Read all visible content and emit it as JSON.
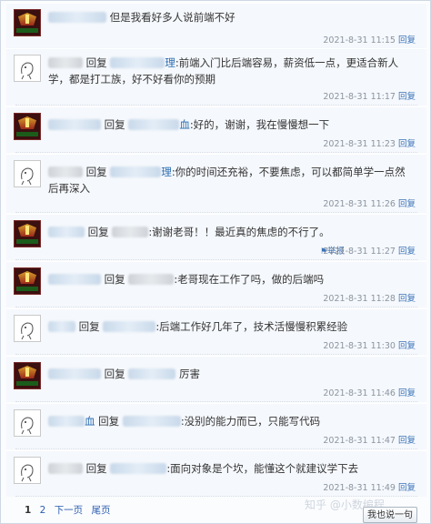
{
  "comments": [
    {
      "avatar": "game",
      "prefix": "",
      "reply_label": "",
      "mention_suffix": "",
      "text": "但是我看好多人说前端不好",
      "line2": "",
      "time": "2021-8-31 11:15",
      "action": "回复"
    },
    {
      "avatar": "sketch",
      "prefix": "",
      "reply_label": "回复",
      "mention_suffix": "理",
      "text": ":前端入门比后端容易，薪资低一点，更适合新人",
      "line2": "学，都是打工族，好不好看你的预期",
      "time": "2021-8-31 11:17",
      "action": "回复"
    },
    {
      "avatar": "game",
      "prefix": "",
      "reply_label": "回复",
      "mention_suffix": "血",
      "text": ":好的，谢谢，我在慢慢想一下",
      "line2": "",
      "time": "2021-8-31 11:23",
      "action": "回复"
    },
    {
      "avatar": "sketch",
      "prefix": "",
      "reply_label": "回复",
      "mention_suffix": "理",
      "text": ":你的时间还充裕，不要焦虑，可以都简单学一点然",
      "line2": "后再深入",
      "time": "2021-8-31 11:26",
      "action": "回复"
    },
    {
      "avatar": "game",
      "prefix": "",
      "reply_label": "回复",
      "mention_suffix": "",
      "text": ":谢谢老哥！！最近真的焦虑的不行了。",
      "line2": "",
      "time": "2021-8-31 11:27",
      "action": "回复",
      "report": "举报"
    },
    {
      "avatar": "game",
      "prefix": "",
      "reply_label": "回复",
      "mention_suffix": "",
      "text": ":老哥现在工作了吗，做的后端吗",
      "line2": "",
      "time": "2021-8-31 11:28",
      "action": "回复"
    },
    {
      "avatar": "sketch",
      "prefix": "",
      "reply_label": "回复",
      "mention_suffix": "",
      "text": ":后端工作好几年了，技术活慢慢积累经验",
      "line2": "",
      "time": "2021-8-31 11:30",
      "action": "回复"
    },
    {
      "avatar": "game",
      "prefix": "",
      "reply_label": "回复",
      "mention_suffix": "",
      "text": "厉害",
      "line2": "",
      "time": "2021-8-31 11:46",
      "action": "回复"
    },
    {
      "avatar": "sketch",
      "prefix": "",
      "reply_label": "回复",
      "mention_suffix": "血",
      "text": ":没别的能力而已，只能写代码",
      "line2": "",
      "time": "2021-8-31 11:47",
      "action": "回复"
    },
    {
      "avatar": "sketch",
      "prefix": "",
      "reply_label": "回复",
      "mention_suffix": "",
      "text": ":面向对象是个坎，能懂这个就建议学下去",
      "line2": "",
      "time": "2021-8-31 11:49",
      "action": "回复"
    }
  ],
  "pager": {
    "current": "1",
    "page2": "2",
    "next": "下一页",
    "last": "尾页"
  },
  "watermark": "知乎 @小数编程",
  "say_button": "我也说一句"
}
